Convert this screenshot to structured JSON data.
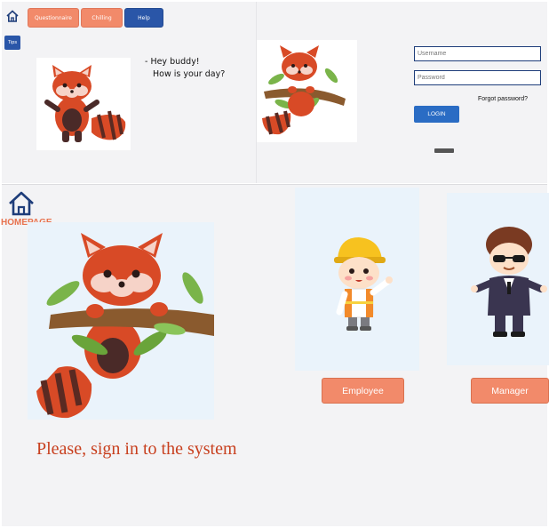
{
  "nav": {
    "questionnaire": "Questionnaire",
    "chilling": "Chilling",
    "help": "Help",
    "tips": "Tips"
  },
  "speech": {
    "line1": "- Hey buddy!",
    "line2": "How is your day?"
  },
  "login": {
    "username_placeholder": "Username",
    "password_placeholder": "Password",
    "forgot": "Forgot password?",
    "button": "LOGIN"
  },
  "homepage": {
    "label": "HOMEPAGE",
    "prompt": "Please, sign in to the system"
  },
  "roles": {
    "employee": "Employee",
    "manager": "Manager"
  },
  "colors": {
    "accent_orange": "#f28a6a",
    "accent_blue": "#2a56a8",
    "prompt_red": "#c8401f"
  }
}
